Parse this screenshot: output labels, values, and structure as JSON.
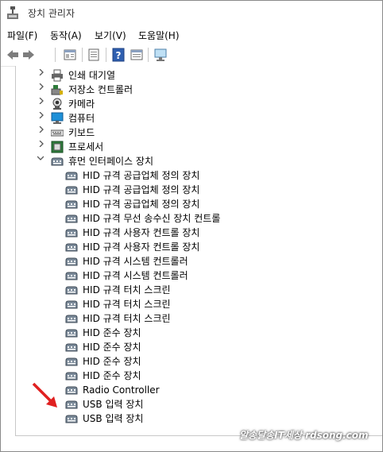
{
  "window": {
    "title": "장치 관리자"
  },
  "menu": [
    "파일(F)",
    "동작(A)",
    "보기(V)",
    "도움말(H)"
  ],
  "toolbar": {
    "buttons": [
      "back-icon",
      "forward-icon",
      "properties-icon",
      "show-hidden-icon",
      "help-icon",
      "view-icon",
      "monitor-icon"
    ]
  },
  "tree": {
    "categories": [
      {
        "label": "인쇄 대기열",
        "icon": "printer-icon",
        "expanded": false
      },
      {
        "label": "저장소 컨트롤러",
        "icon": "storage-controller-icon",
        "expanded": false
      },
      {
        "label": "카메라",
        "icon": "camera-icon",
        "expanded": false
      },
      {
        "label": "컴퓨터",
        "icon": "computer-icon",
        "expanded": false
      },
      {
        "label": "키보드",
        "icon": "keyboard-icon",
        "expanded": false
      },
      {
        "label": "프로세서",
        "icon": "processor-icon",
        "expanded": false
      },
      {
        "label": "휴먼 인터페이스 장치",
        "icon": "hid-icon",
        "expanded": true
      }
    ],
    "hid_devices": [
      "HID 규격 공급업체 정의 장치",
      "HID 규격 공급업체 정의 장치",
      "HID 규격 공급업체 정의 장치",
      "HID 규격 무선 송수신 장치 컨트롤",
      "HID 규격 사용자 컨트롤 장치",
      "HID 규격 사용자 컨트롤 장치",
      "HID 규격 시스템 컨트롤러",
      "HID 규격 시스템 컨트롤러",
      "HID 규격 터치 스크린",
      "HID 규격 터치 스크린",
      "HID 규격 터치 스크린",
      "HID 준수 장치",
      "HID 준수 장치",
      "HID 준수 장치",
      "HID 준수 장치",
      "Radio Controller",
      "USB 입력 장치",
      "USB 입력 장치"
    ]
  },
  "watermark": "알송달송IT세상 rdsong.com",
  "colors": {
    "annotation_arrow": "#e02020",
    "hid_icon": "#6b7b8c"
  }
}
